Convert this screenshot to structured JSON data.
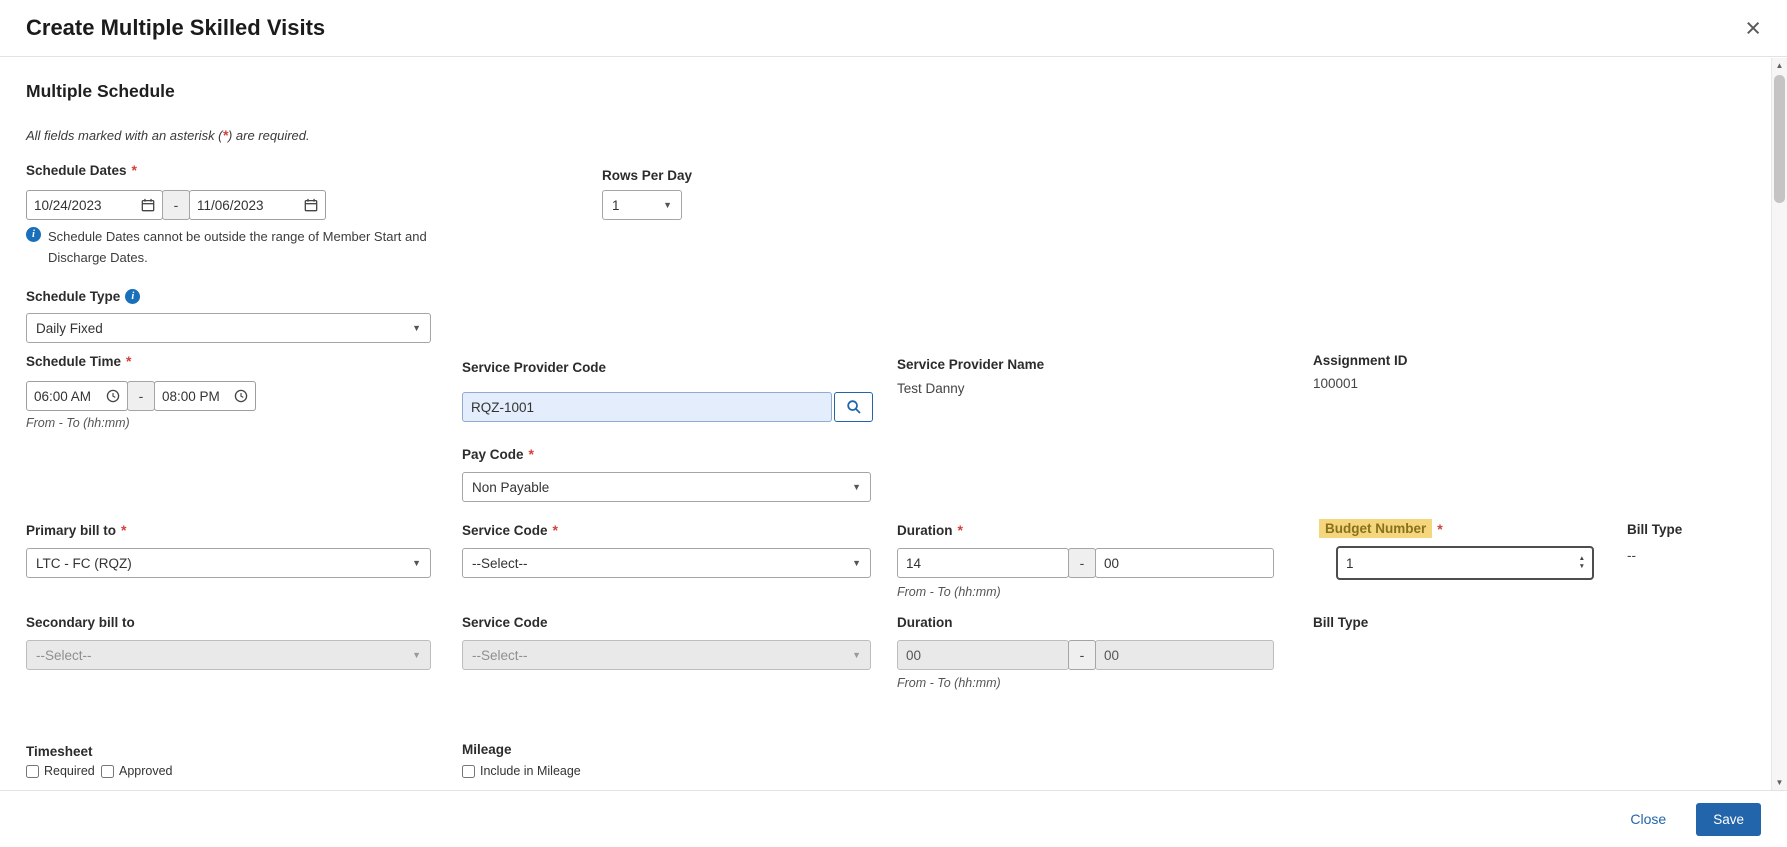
{
  "icons": {
    "close": "×",
    "info": "i",
    "caret": "▼",
    "spin_up": "▲",
    "spin_down": "▼",
    "scroll_up": "▲",
    "scroll_down": "▼",
    "dash": "-"
  },
  "modal": {
    "title": "Create Multiple Skilled Visits"
  },
  "section_title": "Multiple Schedule",
  "required_note": {
    "prefix": "All fields marked with an asterisk (",
    "star": "*",
    "suffix": ") are required."
  },
  "schedule_dates": {
    "label": "Schedule Dates",
    "start_value": "10/24/2023",
    "end_value": "11/06/2023",
    "info_note": "Schedule Dates cannot be outside the range of Member Start and Discharge Dates."
  },
  "rows_per_day": {
    "label": "Rows Per Day",
    "value": "1"
  },
  "schedule_type": {
    "label": "Schedule Type",
    "value": "Daily Fixed"
  },
  "schedule_time": {
    "label": "Schedule Time",
    "start_value": "06:00 AM",
    "end_value": "08:00 PM",
    "hint": "From - To (hh:mm)"
  },
  "service_provider_code": {
    "label": "Service Provider Code",
    "value": "RQZ-1001"
  },
  "service_provider_name": {
    "label": "Service Provider Name",
    "value": "Test Danny"
  },
  "assignment_id": {
    "label": "Assignment ID",
    "value": "100001"
  },
  "pay_code": {
    "label": "Pay Code",
    "value": "Non Payable"
  },
  "primary": {
    "bill_to_label": "Primary bill to",
    "bill_to_value": "LTC - FC (RQZ)",
    "service_code_label": "Service Code",
    "service_code_value": "--Select--",
    "duration_label": "Duration",
    "duration_hours": "14",
    "duration_minutes": "00",
    "duration_hint": "From - To (hh:mm)",
    "budget_number_label": "Budget Number",
    "budget_number_value": "1",
    "bill_type_label": "Bill Type",
    "bill_type_value": "--"
  },
  "secondary": {
    "bill_to_label": "Secondary bill to",
    "bill_to_value": "--Select--",
    "service_code_label": "Service Code",
    "service_code_value": "--Select--",
    "duration_label": "Duration",
    "duration_hours": "00",
    "duration_minutes": "00",
    "duration_hint": "From - To (hh:mm)",
    "bill_type_label": "Bill Type"
  },
  "timesheet": {
    "label": "Timesheet",
    "required_label": "Required",
    "approved_label": "Approved"
  },
  "mileage": {
    "label": "Mileage",
    "include_label": "Include in Mileage"
  },
  "footer": {
    "close_label": "Close",
    "save_label": "Save"
  },
  "colors": {
    "accent_blue": "#2265aa",
    "highlight_yellow": "#f4d77c",
    "required_red": "#d43f3a",
    "info_blue": "#1a6fba"
  }
}
